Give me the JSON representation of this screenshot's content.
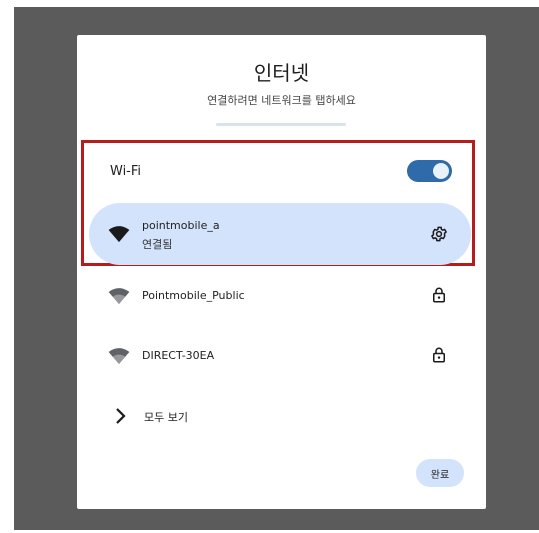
{
  "dialog": {
    "title": "인터넷",
    "subtitle": "연결하려면 네트워크를 탭하세요"
  },
  "wifi": {
    "label": "Wi-Fi",
    "enabled": true
  },
  "networks": [
    {
      "name": "pointmobile_a",
      "status": "연결됨",
      "trailing_icon": "settings-gear-icon",
      "active": true
    },
    {
      "name": "Pointmobile_Public",
      "trailing_icon": "lock-icon",
      "active": false
    },
    {
      "name": "DIRECT-30EA",
      "trailing_icon": "lock-icon",
      "active": false
    }
  ],
  "see_all": {
    "label": "모두 보기",
    "icon": "chevron-right-icon"
  },
  "done_button": {
    "label": "완료"
  },
  "colors": {
    "backdrop": "#5b5b5b",
    "accent": "#2f6bab",
    "active_row": "#d3e3fc",
    "highlight_frame": "#b71c1c"
  }
}
